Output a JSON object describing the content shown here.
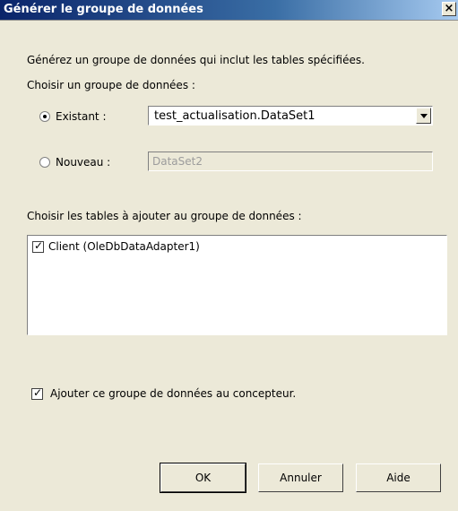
{
  "window": {
    "title": "Générer le groupe de données",
    "close_label": "×"
  },
  "description": "Générez un groupe de données qui inclut les tables spécifiées.",
  "choose_dataset_label": "Choisir un groupe de données :",
  "existing": {
    "label": "Existant :",
    "selected": true,
    "combo_value": "test_actualisation.DataSet1"
  },
  "new": {
    "label": "Nouveau :",
    "selected": false,
    "field_value": "DataSet2"
  },
  "tables_label": "Choisir les tables à ajouter au groupe de données :",
  "tables": [
    {
      "label": "Client (OleDbDataAdapter1)",
      "checked": true
    }
  ],
  "add_to_designer": {
    "label": "Ajouter ce groupe de données au concepteur.",
    "checked": true
  },
  "buttons": {
    "ok": "OK",
    "cancel": "Annuler",
    "help": "Aide"
  }
}
